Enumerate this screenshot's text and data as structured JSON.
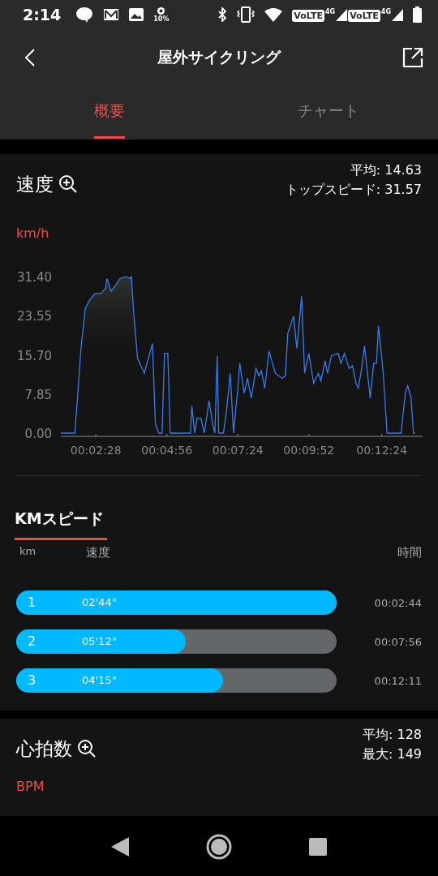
{
  "status_bar": {
    "time": "2:14",
    "brightness": "10%",
    "networks": [
      {
        "badge": "VoLTE",
        "type": "4G"
      },
      {
        "badge": "VoLTE",
        "type": "4G"
      }
    ]
  },
  "header": {
    "title": "屋外サイクリング"
  },
  "tabs": [
    {
      "label": "概要",
      "selected": true
    },
    {
      "label": "チャート",
      "selected": false
    }
  ],
  "speed": {
    "title": "速度",
    "average": "平均: 14.63",
    "top_speed": "トップスピード: 31.57",
    "unit": "km/h",
    "chart_data": {
      "type": "line",
      "x": [
        75,
        104,
        109,
        117,
        126,
        134,
        146,
        159,
        168,
        171,
        180,
        188,
        198,
        210,
        218,
        222,
        227,
        235,
        249,
        266,
        272,
        279,
        286,
        291,
        298,
        303,
        345,
        348,
        354,
        359,
        367,
        374,
        384,
        391,
        396,
        401,
        404,
        414,
        421,
        428,
        435,
        443,
        448,
        457,
        464,
        472,
        482,
        488,
        493,
        500,
        509,
        522,
        536,
        543,
        548,
        560,
        567,
        577,
        583,
        592,
        602,
        612,
        617,
        626,
        631,
        639,
        653,
        659,
        666,
        676,
        683,
        690,
        695,
        702,
        708,
        713,
        720,
        727,
        733,
        737,
        747,
        755,
        784,
        793,
        798,
        805,
        810,
        813
      ],
      "series": [
        {
          "color": "#3b7be8",
          "values": [
            0,
            0,
            6,
            17,
            25,
            26.5,
            28,
            28,
            29,
            31,
            28.5,
            29.5,
            31,
            31.4,
            31,
            31.4,
            24,
            15,
            12,
            18,
            2,
            0,
            0,
            16,
            16,
            0,
            0,
            5.5,
            0,
            3,
            3,
            0,
            6.5,
            2,
            0,
            15.5,
            0,
            0,
            5,
            12,
            0,
            8,
            14,
            8,
            11,
            7,
            13,
            11.5,
            12.5,
            9,
            16.5,
            12,
            11,
            11.5,
            20,
            23.5,
            17,
            27.5,
            12,
            16,
            10,
            12,
            10.5,
            14.5,
            12,
            15.5,
            16,
            14,
            16,
            13,
            13.5,
            10,
            9,
            13,
            17.5,
            13,
            7,
            14,
            14,
            21.5,
            12,
            0,
            0,
            8,
            9.5,
            7,
            0,
            0
          ]
        }
      ],
      "xlim": [
        75,
        829
      ],
      "ylim": [
        0,
        31.4
      ],
      "xticks": [
        {
          "value": 148,
          "label": "00:02:28"
        },
        {
          "value": 296,
          "label": "00:04:56"
        },
        {
          "value": 444,
          "label": "00:07:24"
        },
        {
          "value": 592,
          "label": "00:09:52"
        },
        {
          "value": 744,
          "label": "00:12:24"
        }
      ],
      "yticks": [
        {
          "value": 0,
          "label": "0.00"
        },
        {
          "value": 7.85,
          "label": "7.85"
        },
        {
          "value": 15.7,
          "label": "15.70"
        },
        {
          "value": 23.55,
          "label": "23.55"
        },
        {
          "value": 31.4,
          "label": "31.40"
        }
      ]
    }
  },
  "km_speed": {
    "title": "KMスピード",
    "columns": [
      "km",
      "速度",
      "時間"
    ],
    "rows": [
      {
        "km": "1",
        "pace": "02'44\"",
        "time": "00:02:44",
        "level": 1
      },
      {
        "km": "2",
        "pace": "05'12\"",
        "time": "00:07:56",
        "level": 0.53
      },
      {
        "km": "3",
        "pace": "04'15\"",
        "time": "00:12:11",
        "level": 0.645
      }
    ]
  },
  "heart_rate": {
    "title": "心拍数",
    "average": "平均: 128",
    "max": "最大: 149",
    "unit": "BPM"
  }
}
